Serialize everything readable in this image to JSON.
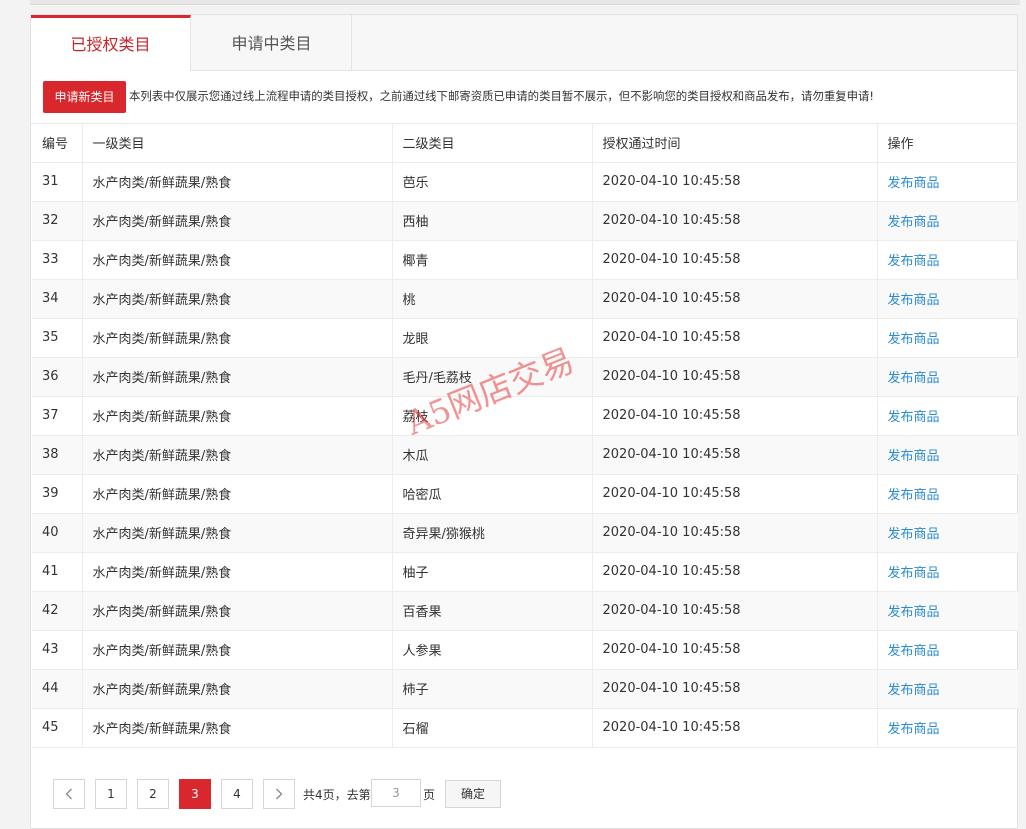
{
  "tabs": [
    {
      "label": "已授权类目"
    },
    {
      "label": "申请中类目"
    }
  ],
  "notice": {
    "apply_button": "申请新类目",
    "text": "本列表中仅展示您通过线上流程申请的类目授权，之前通过线下邮寄资质已申请的类目暂不展示，但不影响您的类目授权和商品发布，请勿重复申请!"
  },
  "table": {
    "columns": [
      "编号",
      "一级类目",
      "二级类目",
      "授权通过时间",
      "操作"
    ],
    "rows": [
      {
        "id": "31",
        "cat1": "水产肉类/新鲜蔬果/熟食",
        "cat2": "芭乐",
        "time": "2020-04-10 10:45:58",
        "action": "发布商品"
      },
      {
        "id": "32",
        "cat1": "水产肉类/新鲜蔬果/熟食",
        "cat2": "西柚",
        "time": "2020-04-10 10:45:58",
        "action": "发布商品"
      },
      {
        "id": "33",
        "cat1": "水产肉类/新鲜蔬果/熟食",
        "cat2": "椰青",
        "time": "2020-04-10 10:45:58",
        "action": "发布商品"
      },
      {
        "id": "34",
        "cat1": "水产肉类/新鲜蔬果/熟食",
        "cat2": "桃",
        "time": "2020-04-10 10:45:58",
        "action": "发布商品"
      },
      {
        "id": "35",
        "cat1": "水产肉类/新鲜蔬果/熟食",
        "cat2": "龙眼",
        "time": "2020-04-10 10:45:58",
        "action": "发布商品"
      },
      {
        "id": "36",
        "cat1": "水产肉类/新鲜蔬果/熟食",
        "cat2": "毛丹/毛荔枝",
        "time": "2020-04-10 10:45:58",
        "action": "发布商品"
      },
      {
        "id": "37",
        "cat1": "水产肉类/新鲜蔬果/熟食",
        "cat2": "荔枝",
        "time": "2020-04-10 10:45:58",
        "action": "发布商品"
      },
      {
        "id": "38",
        "cat1": "水产肉类/新鲜蔬果/熟食",
        "cat2": "木瓜",
        "time": "2020-04-10 10:45:58",
        "action": "发布商品"
      },
      {
        "id": "39",
        "cat1": "水产肉类/新鲜蔬果/熟食",
        "cat2": "哈密瓜",
        "time": "2020-04-10 10:45:58",
        "action": "发布商品"
      },
      {
        "id": "40",
        "cat1": "水产肉类/新鲜蔬果/熟食",
        "cat2": "奇异果/猕猴桃",
        "time": "2020-04-10 10:45:58",
        "action": "发布商品"
      },
      {
        "id": "41",
        "cat1": "水产肉类/新鲜蔬果/熟食",
        "cat2": "柚子",
        "time": "2020-04-10 10:45:58",
        "action": "发布商品"
      },
      {
        "id": "42",
        "cat1": "水产肉类/新鲜蔬果/熟食",
        "cat2": "百香果",
        "time": "2020-04-10 10:45:58",
        "action": "发布商品"
      },
      {
        "id": "43",
        "cat1": "水产肉类/新鲜蔬果/熟食",
        "cat2": "人参果",
        "time": "2020-04-10 10:45:58",
        "action": "发布商品"
      },
      {
        "id": "44",
        "cat1": "水产肉类/新鲜蔬果/熟食",
        "cat2": "柿子",
        "time": "2020-04-10 10:45:58",
        "action": "发布商品"
      },
      {
        "id": "45",
        "cat1": "水产肉类/新鲜蔬果/熟食",
        "cat2": "石榴",
        "time": "2020-04-10 10:45:58",
        "action": "发布商品"
      }
    ]
  },
  "pager": {
    "pages": [
      "1",
      "2",
      "3",
      "4"
    ],
    "current": "3",
    "total_text": "共4页，去第",
    "page_input_value": "3",
    "page_suffix": "页",
    "confirm_label": "确定",
    "prev_icon": "chevron-left-icon",
    "next_icon": "chevron-right-icon"
  },
  "watermark": "A5网店交易",
  "colors": {
    "accent": "#d9272e",
    "link": "#2a8bd2"
  }
}
